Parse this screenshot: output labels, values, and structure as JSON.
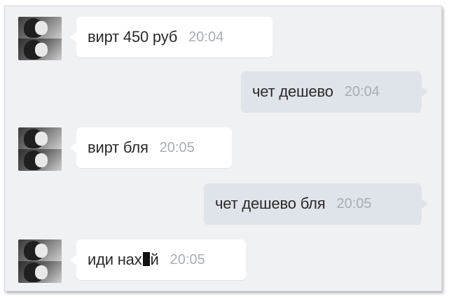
{
  "messages": [
    {
      "direction": "incoming",
      "text": "вирт 450 руб",
      "time": "20:04"
    },
    {
      "direction": "outgoing",
      "text": "чет дешево",
      "time": "20:04"
    },
    {
      "direction": "incoming",
      "text": "вирт бля",
      "time": "20:05"
    },
    {
      "direction": "outgoing",
      "text": "чет дешево бля",
      "time": "20:05"
    },
    {
      "direction": "incoming",
      "text_before": "иди нах",
      "text_after": "й",
      "time": "20:05"
    }
  ]
}
